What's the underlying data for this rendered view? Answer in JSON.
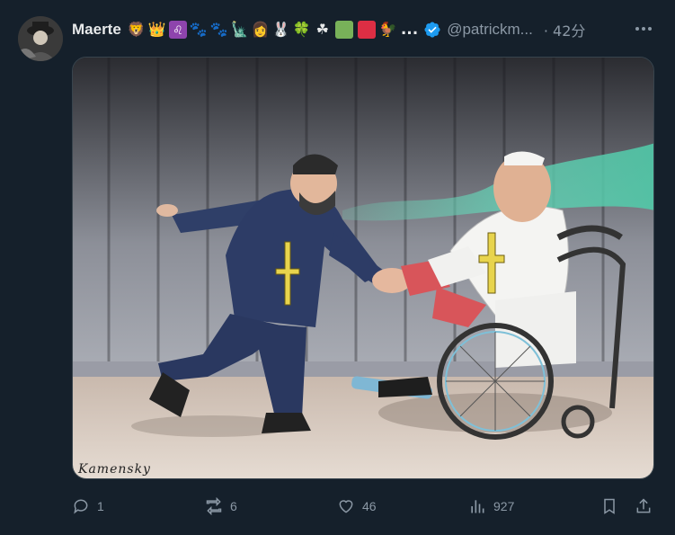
{
  "author": {
    "name": "Maerte",
    "handle": "@patrickm...",
    "time": "· 42分",
    "emoji_icons": [
      "lion-icon",
      "crown-icon",
      "leo-sign-icon",
      "paw-prints-icon",
      "paw-prints-icon",
      "statue-of-liberty-icon",
      "woman-icon",
      "rabbit-icon",
      "four-leaf-clover-icon",
      "shamrock-icon",
      "green-square-icon",
      "red-square-icon",
      "rooster-icon"
    ],
    "ellipsis": "...",
    "verified_color": "#1d9bf0"
  },
  "media": {
    "signature": "Kamensky"
  },
  "actions": {
    "replies": "1",
    "reposts": "6",
    "likes": "46",
    "views": "927"
  },
  "colors": {
    "background": "#15202b",
    "muted": "#8b98a5",
    "accent": "#1d9bf0"
  }
}
